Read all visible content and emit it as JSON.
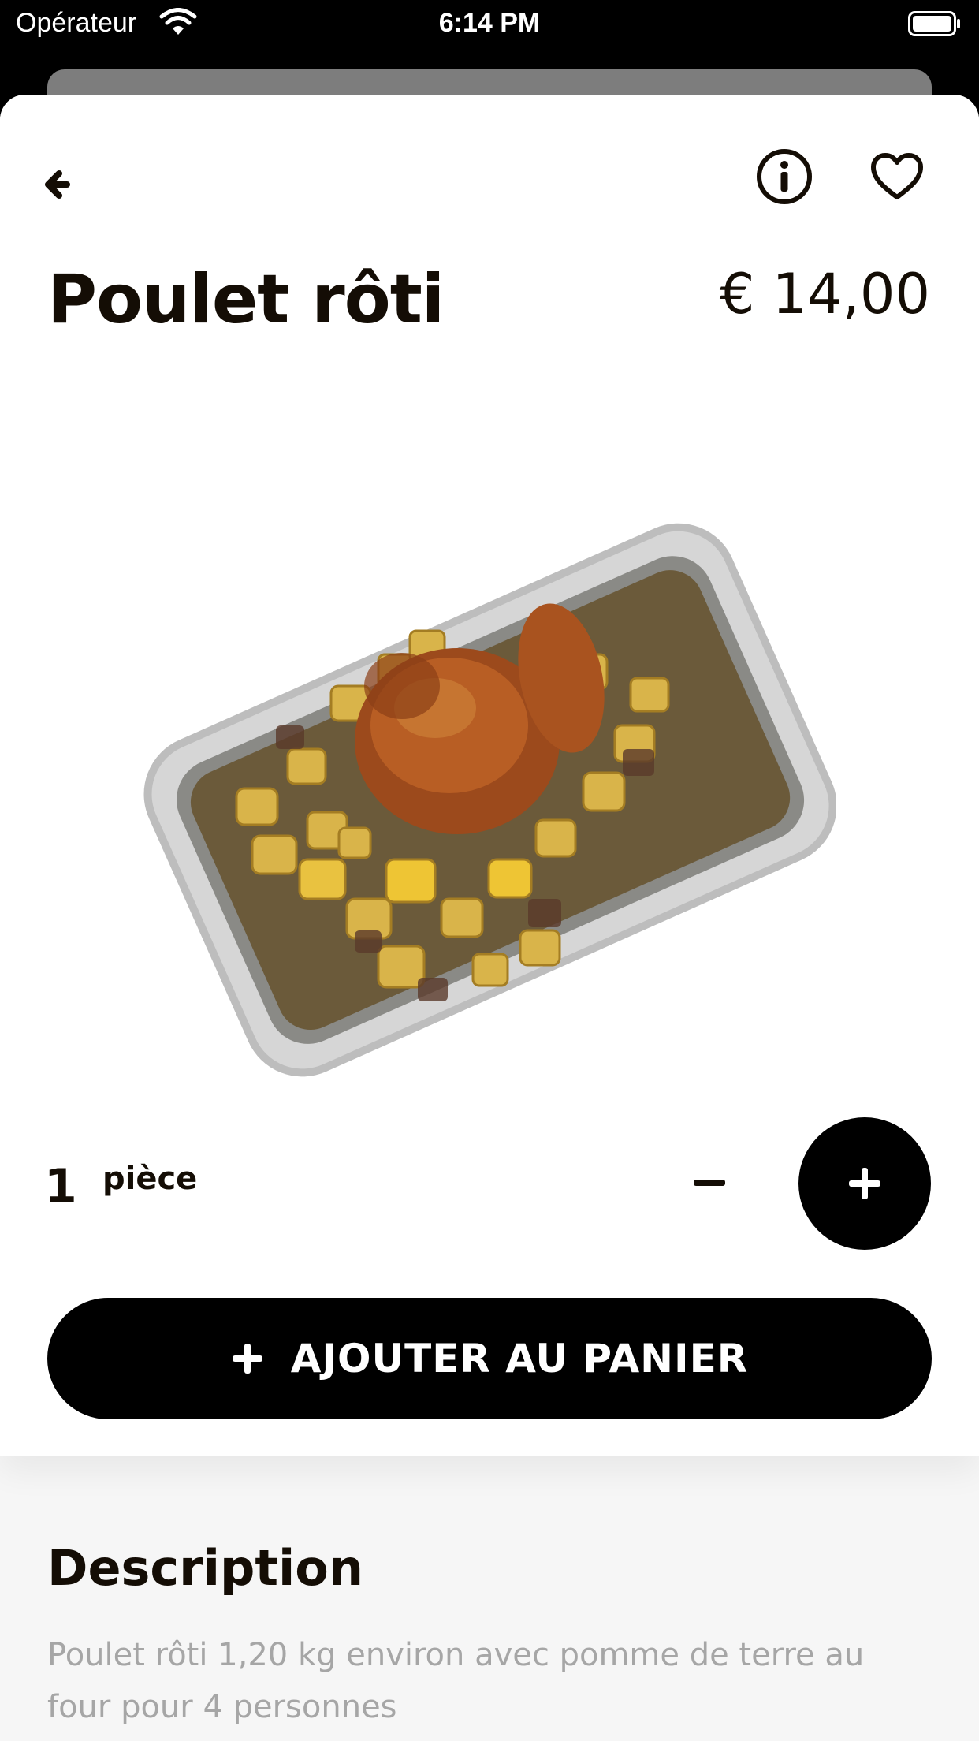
{
  "status_bar": {
    "carrier": "Opérateur",
    "time": "6:14 PM"
  },
  "product": {
    "title": "Poulet rôti",
    "price": "€ 14,00",
    "image_alt": "roast-chicken-with-potatoes-in-foil-tray"
  },
  "quantity": {
    "value": "1",
    "unit": "pièce"
  },
  "cart_button": {
    "label": "AJOUTER AU PANIER"
  },
  "description": {
    "heading": "Description",
    "text": "Poulet rôti 1,20 kg environ avec pomme de terre au four pour 4 personnes"
  },
  "icons": [
    "back-arrow-icon",
    "info-icon",
    "heart-icon",
    "minus-icon",
    "plus-icon",
    "wifi-icon",
    "battery-icon"
  ],
  "colors": {
    "text": "#140d05",
    "accent": "#000000",
    "muted": "#a6a6a6"
  }
}
